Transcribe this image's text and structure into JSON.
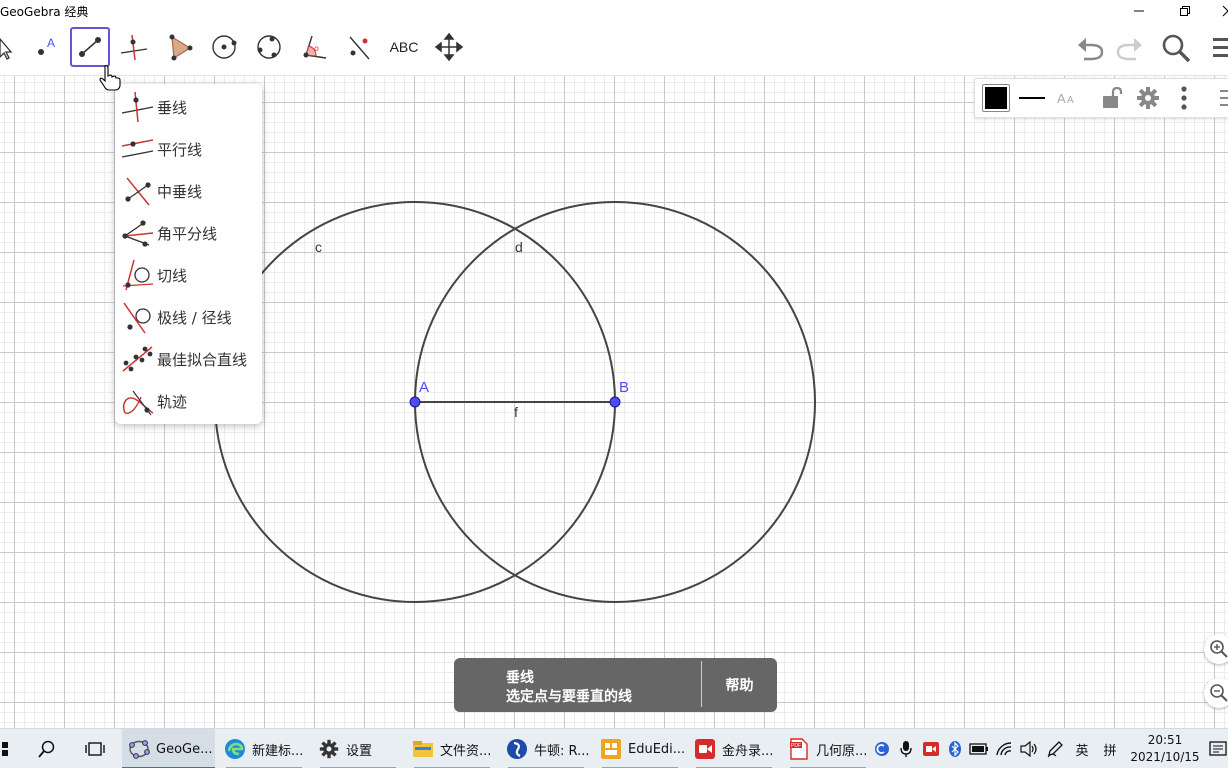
{
  "window": {
    "title": "GeoGebra 经典"
  },
  "toolbar": {
    "text_tool_label": "ABC",
    "tools": [
      "move-tool",
      "point-tool",
      "line-tool",
      "perpendicular-tool",
      "polygon-tool",
      "circle-tool",
      "conic-tool",
      "angle-tool",
      "reflect-tool",
      "text-tool",
      "move-view-tool"
    ],
    "active_tool": "line-tool"
  },
  "dropdown": {
    "items": [
      {
        "label": "垂线",
        "icon": "perpendicular-line-icon"
      },
      {
        "label": "平行线",
        "icon": "parallel-line-icon"
      },
      {
        "label": "中垂线",
        "icon": "perpendicular-bisector-icon"
      },
      {
        "label": "角平分线",
        "icon": "angle-bisector-icon"
      },
      {
        "label": "切线",
        "icon": "tangent-icon"
      },
      {
        "label": "极线 / 径线",
        "icon": "polar-line-icon"
      },
      {
        "label": "最佳拟合直线",
        "icon": "best-fit-line-icon"
      },
      {
        "label": "轨迹",
        "icon": "locus-icon"
      }
    ]
  },
  "canvas": {
    "labels": {
      "circle_c": "c",
      "circle_d": "d",
      "point_a": "A",
      "point_b": "B",
      "segment_f": "f"
    },
    "colors": {
      "point": "#4d4dff",
      "point_label": "#4d4dff",
      "curve": "#444444"
    }
  },
  "tooltip": {
    "tool_name": "垂线",
    "hint": "选定点与要垂直的线",
    "help": "帮助"
  },
  "taskbar": {
    "apps": [
      {
        "label": "GeoGe...",
        "icon": "geogebra-icon"
      },
      {
        "label": "新建标...",
        "icon": "edge-icon"
      },
      {
        "label": "设置",
        "icon": "settings-icon"
      },
      {
        "label": "文件资...",
        "icon": "file-explorer-icon"
      },
      {
        "label": "牛顿: R...",
        "icon": "newton-icon"
      },
      {
        "label": "EduEdi...",
        "icon": "eduedit-icon"
      },
      {
        "label": "金舟录...",
        "icon": "recorder-icon"
      },
      {
        "label": "几何原...",
        "icon": "pdf-icon"
      }
    ],
    "ime_lang": "英",
    "ime_mode": "拼",
    "time": "20:51",
    "date": "2021/10/15"
  }
}
